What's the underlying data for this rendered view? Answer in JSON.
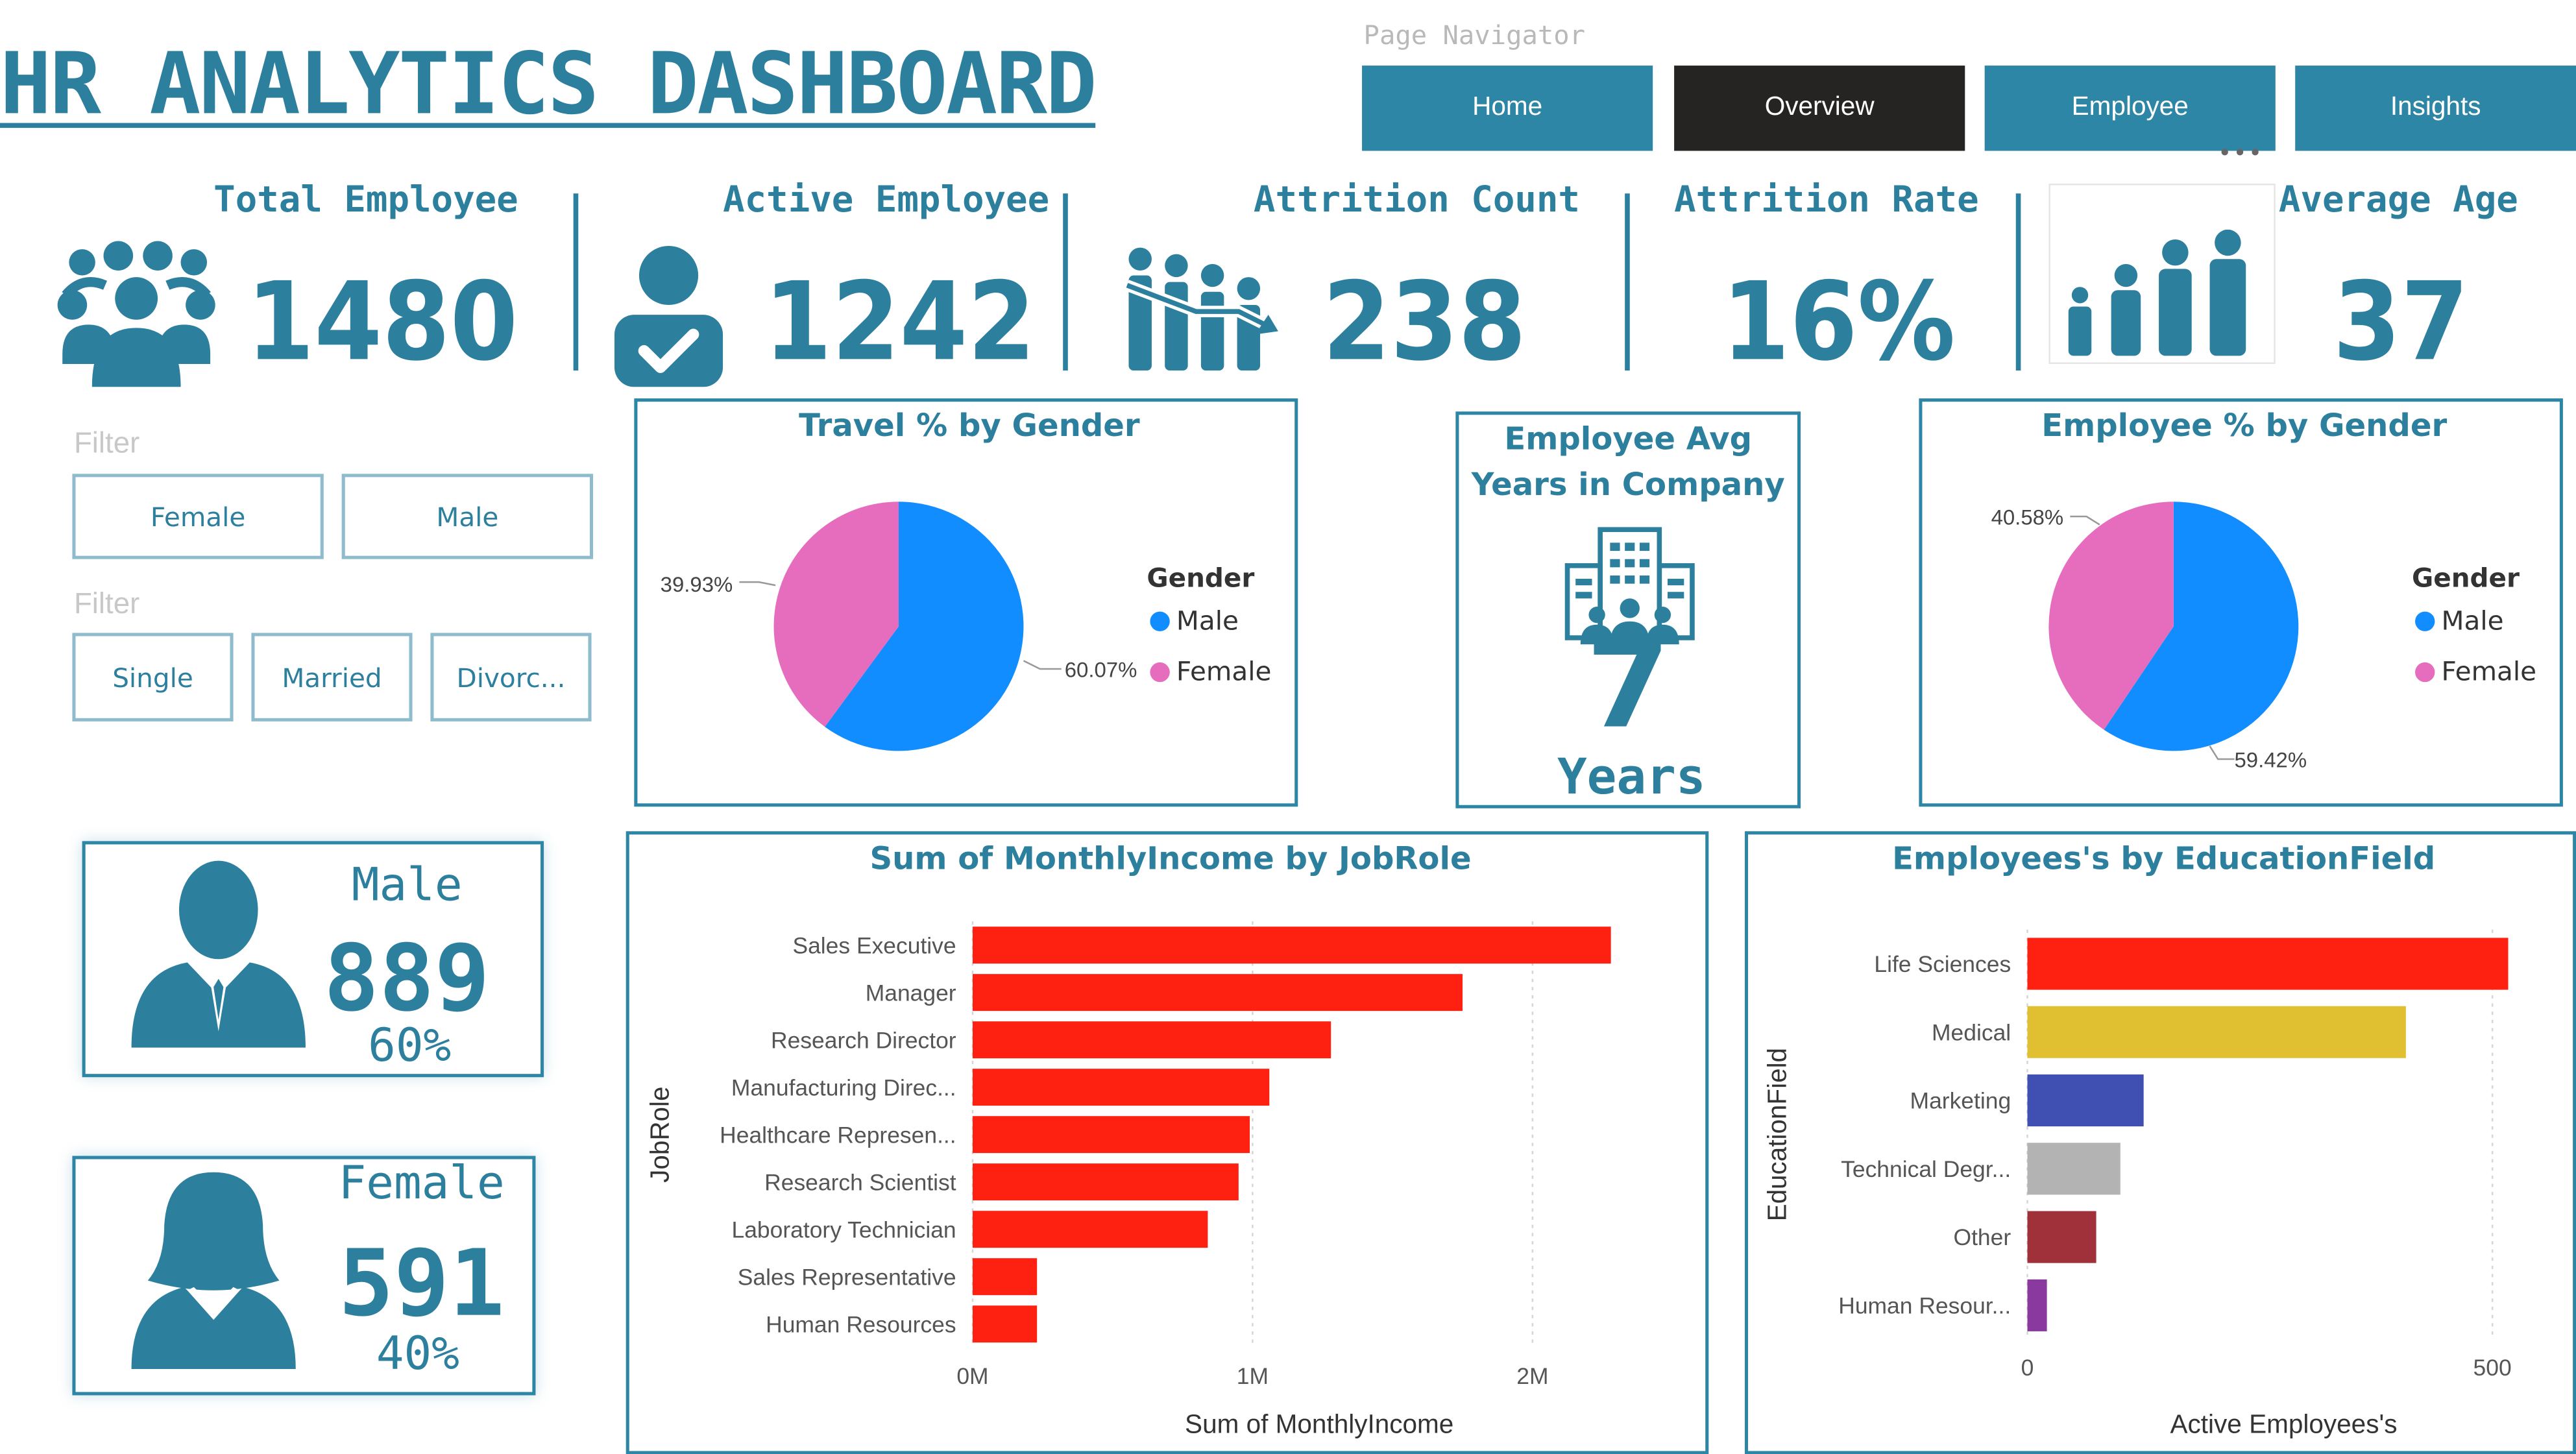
{
  "header": {
    "title": "HR ANALYTICS DASHBOARD",
    "nav_label": "Page Navigator",
    "nav_buttons": [
      "Home",
      "Overview",
      "Employee",
      "Insights"
    ],
    "active_nav": "Overview",
    "more_dots": "•••"
  },
  "kpis": {
    "total_employee": {
      "label": "Total Employee",
      "value": "1480"
    },
    "active_employee": {
      "label": "Active Employee",
      "value": "1242"
    },
    "attrition_count": {
      "label": "Attrition Count",
      "value": "238"
    },
    "attrition_rate": {
      "label": "Attrition Rate",
      "value": "16%"
    },
    "average_age": {
      "label": "Average Age",
      "value": "37"
    }
  },
  "filters": {
    "gender_label": "Filter",
    "gender_options": [
      "Female",
      "Male"
    ],
    "marital_label": "Filter",
    "marital_options": [
      "Single",
      "Married",
      "Divorc..."
    ]
  },
  "gender_cards": {
    "male": {
      "label": "Male",
      "value": "889",
      "pct": "60%"
    },
    "female": {
      "label": "Female",
      "value": "591",
      "pct": "40%"
    }
  },
  "avg_years": {
    "title_line1": "Employee Avg",
    "title_line2": "Years in Company",
    "value": "7",
    "unit": "Years"
  },
  "colors": {
    "primary": "#2d86a6",
    "dark": "#252423",
    "male": "#118dff",
    "female": "#e66cbe",
    "bar_red": "#fe2010"
  },
  "chart_data": [
    {
      "type": "pie",
      "title": "Travel % by Gender",
      "legend_title": "Gender",
      "legend": [
        "Male",
        "Female"
      ],
      "labels": [
        "Male",
        "Female"
      ],
      "values": [
        60.07,
        39.93
      ],
      "value_labels": [
        "60.07%",
        "39.93%"
      ],
      "colors": [
        "#118dff",
        "#e66cbe"
      ],
      "legend_position": "right"
    },
    {
      "type": "pie",
      "title": "Employee % by Gender",
      "legend_title": "Gender",
      "legend": [
        "Male",
        "Female"
      ],
      "labels": [
        "Male",
        "Female"
      ],
      "values": [
        59.42,
        40.58
      ],
      "value_labels": [
        "59.42%",
        "40.58%"
      ],
      "colors": [
        "#118dff",
        "#e66cbe"
      ],
      "legend_position": "right"
    },
    {
      "type": "bar",
      "orientation": "horizontal",
      "title": "Sum of MonthlyIncome by JobRole",
      "categories": [
        "Sales Executive",
        "Manager",
        "Research Director",
        "Manufacturing Direc...",
        "Healthcare Represen...",
        "Research Scientist",
        "Laboratory Technician",
        "Sales Representative",
        "Human Resources"
      ],
      "values": [
        2280000,
        1750000,
        1280000,
        1060000,
        990000,
        950000,
        840000,
        230000,
        230000
      ],
      "xlabel": "Sum of MonthlyIncome",
      "ylabel": "JobRole",
      "xlim": [
        0,
        2500000
      ],
      "xticks": [
        0,
        1000000,
        2000000
      ],
      "xtick_labels": [
        "0M",
        "1M",
        "2M"
      ],
      "grid": true,
      "color": "#fe2010"
    },
    {
      "type": "bar",
      "orientation": "horizontal",
      "title": "Employees's by EducationField",
      "categories": [
        "Life Sciences",
        "Medical",
        "Marketing",
        "Technical Degr...",
        "Other",
        "Human Resour..."
      ],
      "values": [
        517,
        407,
        125,
        100,
        74,
        21
      ],
      "xlabel": "Active Employees's",
      "ylabel": "EducationField",
      "xlim": [
        0,
        560
      ],
      "xticks": [
        0,
        500
      ],
      "xtick_labels": [
        "0",
        "500"
      ],
      "grid": true,
      "colors": [
        "#fe2010",
        "#e0c030",
        "#3f4fb2",
        "#b3b3b3",
        "#a0303a",
        "#8a3a9e"
      ]
    }
  ]
}
